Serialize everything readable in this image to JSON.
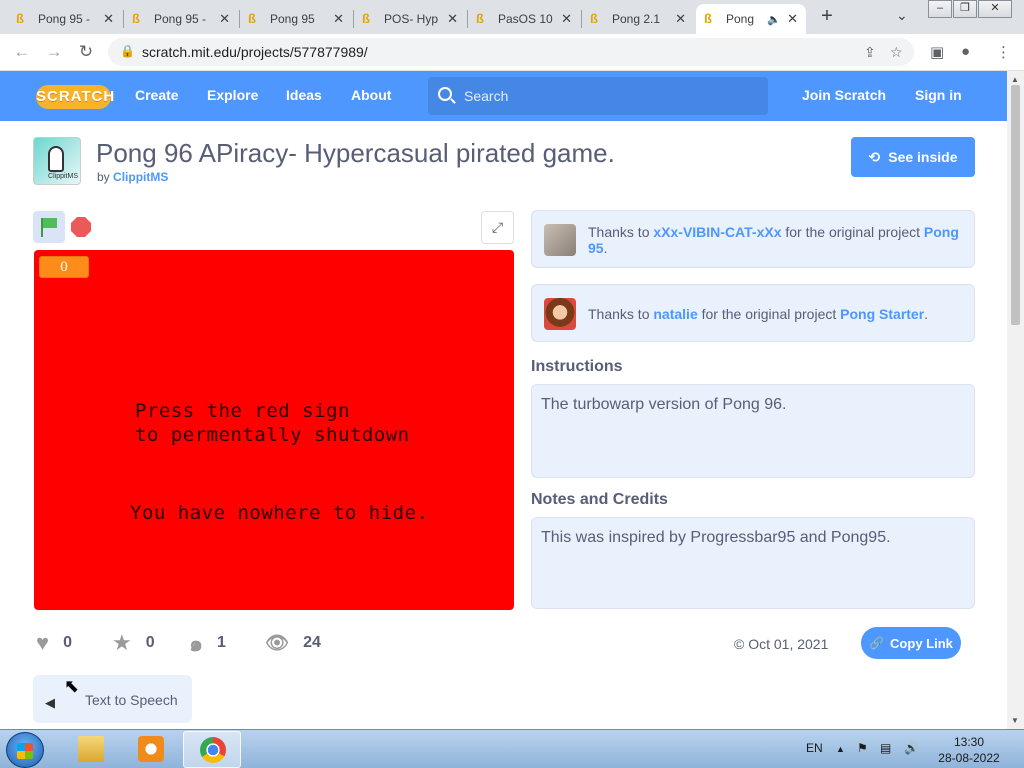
{
  "browser": {
    "tabs": [
      {
        "title": "Pong 95 -"
      },
      {
        "title": "Pong 95 -"
      },
      {
        "title": "Pong 95"
      },
      {
        "title": "POS- Hyp"
      },
      {
        "title": "PasOS 10"
      },
      {
        "title": "Pong 2.1"
      },
      {
        "title": "Pong"
      }
    ],
    "url": "scratch.mit.edu/projects/577877989/"
  },
  "nav": {
    "logo": "SCRATCH",
    "create": "Create",
    "explore": "Explore",
    "ideas": "Ideas",
    "about": "About",
    "search_placeholder": "Search",
    "join": "Join Scratch",
    "signin": "Sign in"
  },
  "project": {
    "thumb_label": "ClippitMS",
    "title": "Pong 96 APiracy- Hypercasual pirated game.",
    "by": "by",
    "author": "ClippitMS",
    "see_inside": "See inside"
  },
  "stage": {
    "score": "0",
    "line1": "Press the red sign",
    "line2": "to permentally shutdown",
    "line3": "You have nowhere to hide.",
    "background": "#ff0000"
  },
  "stats": {
    "loves": "0",
    "favorites": "0",
    "remixes": "1",
    "views": "24",
    "date": "Oct 01, 2021",
    "copy_link": "Copy Link"
  },
  "tts": {
    "label": "Text to Speech"
  },
  "credits": [
    {
      "prefix": "Thanks to",
      "user": "xXx-VIBIN-CAT-xXx",
      "middle": "for the original project",
      "project": "Pong 95",
      "suffix": "."
    },
    {
      "prefix": "Thanks to",
      "user": "natalie",
      "middle": "for the original project",
      "project": "Pong Starter",
      "suffix": "."
    }
  ],
  "instructions": {
    "heading": "Instructions",
    "text": "The turbowarp version of Pong 96."
  },
  "notes": {
    "heading": "Notes and Credits",
    "text": "This was inspired by Progressbar95 and Pong95."
  },
  "taskbar": {
    "lang": "EN",
    "time": "13:30",
    "date": "28-08-2022"
  },
  "colors": {
    "scratch_blue": "#4d97ff",
    "stage_red": "#ff0000",
    "text_gray": "#575e75"
  }
}
